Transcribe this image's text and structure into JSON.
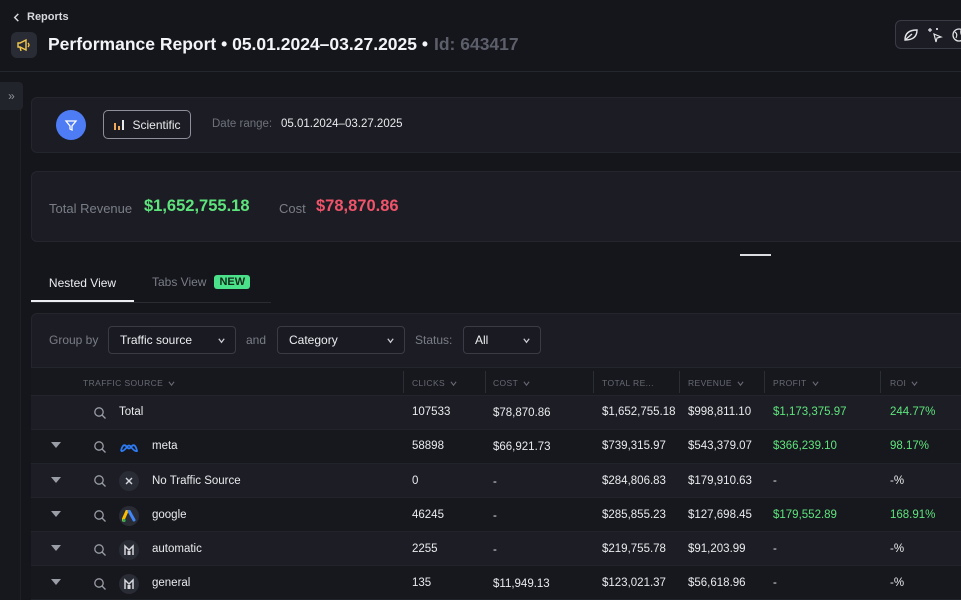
{
  "header": {
    "back_label": "Reports",
    "title": "Performance Report • 05.01.2024–03.27.2025 •",
    "id_label": "Id: 643417"
  },
  "filters": {
    "view_button_label": "Scientific",
    "date_range_label": "Date range:",
    "date_range_value": "05.01.2024–03.27.2025"
  },
  "totals": {
    "revenue_label": "Total Revenue",
    "revenue_value": "$1,652,755.18",
    "cost_label": "Cost",
    "cost_value": "$78,870.86"
  },
  "tabs": {
    "nested_label": "Nested View",
    "tabs_label": "Tabs View",
    "new_badge": "NEW"
  },
  "grouping": {
    "group_by_label": "Group by",
    "group_by_value": "Traffic source",
    "and_label": "and",
    "second_value": "Category",
    "status_label": "Status:",
    "status_value": "All"
  },
  "table": {
    "headers": [
      "TRAFFIC SOURCE",
      "CLICKS",
      "COST",
      "TOTAL RE...",
      "REVENUE",
      "PROFIT",
      "ROI"
    ],
    "rows": [
      {
        "name": "Total",
        "clicks": "107533",
        "cost": "$78,870.86",
        "total_revenue": "$1,652,755.18",
        "revenue": "$998,811.10",
        "profit": "$1,173,375.97",
        "roi": "244.77%",
        "icon": "none"
      },
      {
        "name": "meta",
        "clicks": "58898",
        "cost": "$66,921.73",
        "total_revenue": "$739,315.97",
        "revenue": "$543,379.07",
        "profit": "$366,239.10",
        "roi": "98.17%",
        "icon": "meta-icon"
      },
      {
        "name": "No Traffic Source",
        "clicks": "0",
        "cost": "-",
        "total_revenue": "$284,806.83",
        "revenue": "$179,910.63",
        "profit": "-",
        "roi": "-%",
        "icon": "close-icon"
      },
      {
        "name": "google",
        "clicks": "46245",
        "cost": "-",
        "total_revenue": "$285,855.23",
        "revenue": "$127,698.45",
        "profit": "$179,552.89",
        "roi": "168.91%",
        "icon": "google-ads-icon"
      },
      {
        "name": "automatic",
        "clicks": "2255",
        "cost": "-",
        "total_revenue": "$219,755.78",
        "revenue": "$91,203.99",
        "profit": "-",
        "roi": "-%",
        "icon": "tiktok-like-icon"
      },
      {
        "name": "general",
        "clicks": "135",
        "cost": "$11,949.13",
        "total_revenue": "$123,021.37",
        "revenue": "$56,618.96",
        "profit": "-",
        "roi": "-%",
        "icon": "tiktok-like-icon"
      }
    ]
  },
  "colors": {
    "background": "#15161c",
    "panel": "#1c1d24",
    "accent_blue": "#4e7cf5",
    "positive": "#5ee47c",
    "negative": "#f0546a",
    "badge_new": "#4be08a"
  }
}
